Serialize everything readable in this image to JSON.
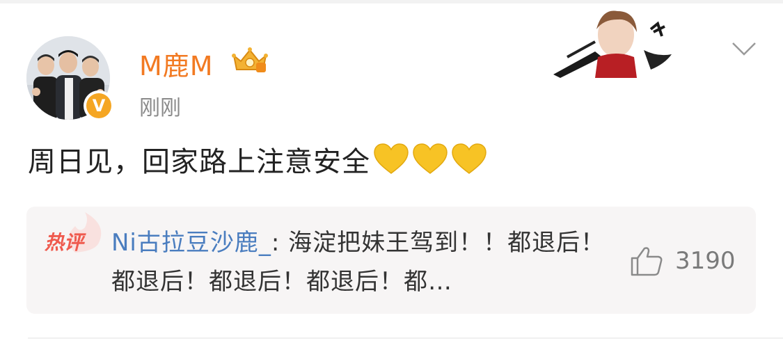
{
  "post": {
    "username": "M鹿M",
    "timestamp": "刚刚",
    "verified_mark": "V",
    "text": "周日见，回家路上注意安全",
    "emoji": [
      "yellow-heart",
      "yellow-heart",
      "yellow-heart"
    ]
  },
  "hot_comment": {
    "label": "热评",
    "user": "Ni古拉豆沙鹿_",
    "separator": ": ",
    "text": "海淀把妹王驾到！！都退后！都退后！都退后！都退后！都…",
    "like_count": "3190"
  },
  "colors": {
    "username": "#f27a22",
    "comment_user": "#4a7dbf",
    "hot_label": "#ef5a4e",
    "heart": "#f7c325"
  },
  "icons": [
    "verified-icon",
    "crown-badge-icon",
    "chevron-down-icon",
    "yellow-heart-icon",
    "thumbs-up-icon"
  ]
}
